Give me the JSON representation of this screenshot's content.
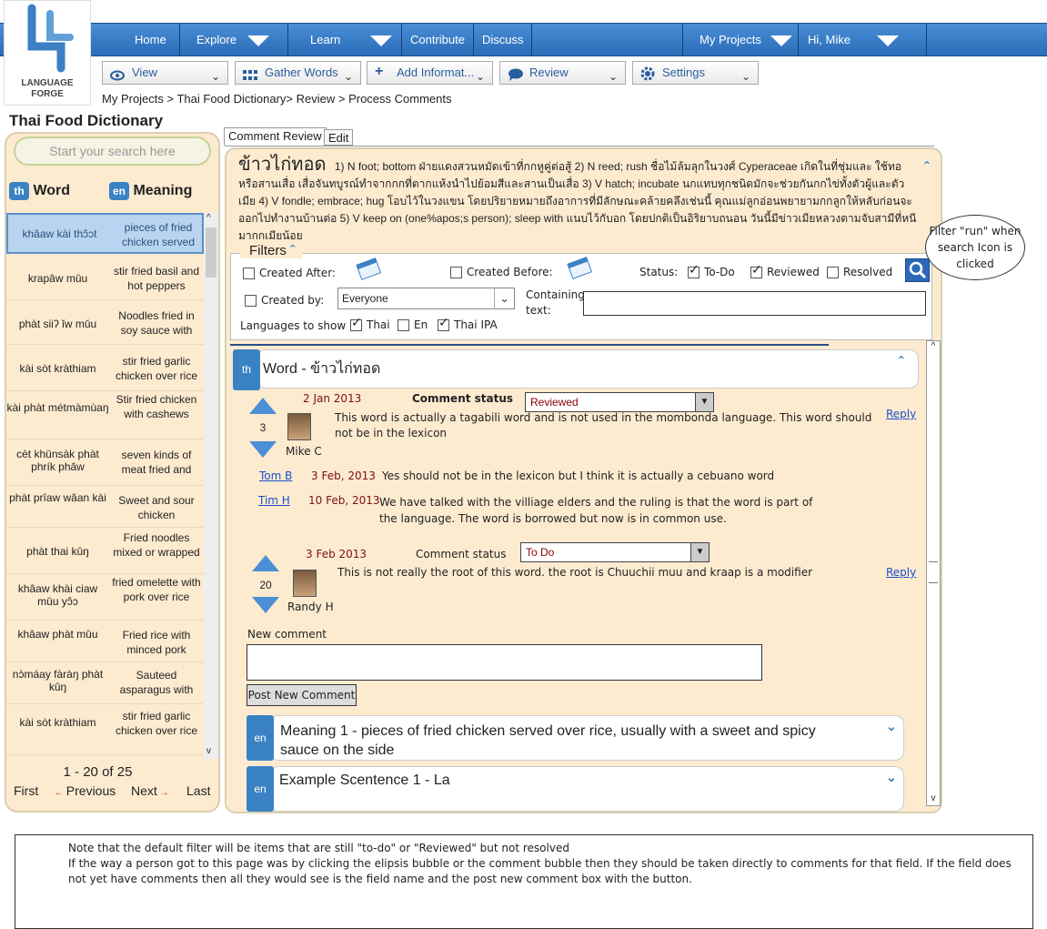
{
  "logo": {
    "line1": "LANGUAGE",
    "line2": "FORGE"
  },
  "topnav": {
    "home": "Home",
    "explore": "Explore",
    "learn": "Learn",
    "contribute": "Contribute",
    "discuss": "Discuss",
    "my_projects": "My Projects",
    "greeting": "Hi, Mike"
  },
  "subnav": {
    "view": "View",
    "gather_words": "Gather Words",
    "add_information": "Add Informat...",
    "review": "Review",
    "settings": "Settings"
  },
  "breadcrumb": "My Projects > Thai Food Dictionary> Review > Process Comments",
  "page_title": "Thai Food Dictionary",
  "left": {
    "search_placeholder": "Start your search here",
    "word_lang": "th",
    "word_header": "Word",
    "meaning_lang": "en",
    "meaning_header": "Meaning",
    "rows": [
      {
        "word": "khâaw kài thɔ̂ɔt",
        "meaning": "pieces of fried chicken served"
      },
      {
        "word": "krapâw mǔu",
        "meaning": "stir fried basil and hot peppers"
      },
      {
        "word": "phàt siiʔ ǐw mǔu",
        "meaning": "Noodles fried in soy sauce with"
      },
      {
        "word": "kài sòt kràthiam",
        "meaning": "stir fried garlic chicken over rice"
      },
      {
        "word": "kài phàt métmàmùaŋ",
        "meaning": "Stir fried chicken with cashews"
      },
      {
        "word": "cèt khǔnsàk phàt phrík phǎw",
        "meaning": "seven kinds of meat fried and"
      },
      {
        "word": "phàt prîaw wǎan kài",
        "meaning": "Sweet and sour chicken"
      },
      {
        "word": "phàt thai kûŋ",
        "meaning": "Fried noodles mixed or wrapped"
      },
      {
        "word": "khâaw khài ciaw mǔu yɔ̂ɔ",
        "meaning": "fried omelette with pork over rice"
      },
      {
        "word": "khâaw phàt mǔu",
        "meaning": "Fried rice with minced pork"
      },
      {
        "word": "nɔ̀máay fàràŋ phàt kûŋ",
        "meaning": "Sauteed asparagus with"
      },
      {
        "word": "kài sòt kràthiam",
        "meaning": "stir fried garlic chicken over rice"
      }
    ],
    "pager": {
      "range": "1 - 20 of 25",
      "first": "First",
      "previous": "Previous",
      "next": "Next",
      "last": "Last"
    }
  },
  "tabs": {
    "comment_review": "Comment Review",
    "edit": "Edit"
  },
  "entry": {
    "headword": "ข้าวไก่ทอด",
    "text": "1) N  foot; bottom ฝ่ายแดงสวนหมัดเข้าที่กกหูคู่ต่อสู้    2) N  reed; rush ชื่อไม้ล้มลุกในวงศ์ Cyperaceae เกิดในที่ชุ่มและ ใช้ทอหรือสานเสื่อ เสื่อจันทบูรณ์ทำจากกกที่ตากแห้งนำไปย้อมสีและสานเป็นเสื่อ    3) V  hatch; incubate นกแทบทุกชนิดมักจะช่วยกันกกไข่ทั้งตัวผู้และตัวเมีย    4) V  fondle; embrace; hug โอบไว้ในวงแขน โดยปริยายหมายถึงอาการที่มีลักษณะคล้ายคลึงเช่นนี้ คุณแม่ลูกอ่อนพยายามกกลูกให้หลับก่อนจะออกไปทำงานบ้านต่อ    5) V  keep on (one%apos;s person); sleep with แนบไว้กับอก โดยปกติเป็นอิริยาบถนอน วันนี้มีข่าวเมียหลวงตามจับสามีที่หนีมากกเมียน้อย"
  },
  "filters": {
    "title": "Filters",
    "created_after": "Created After:",
    "created_before": "Created Before:",
    "status_label": "Status:",
    "todo": "To-Do",
    "reviewed": "Reviewed",
    "resolved": "Resolved",
    "created_by": "Created by:",
    "created_by_value": "Everyone",
    "containing_text": "Containing text:",
    "languages_label": "Languages to show",
    "lang_thai": "Thai",
    "lang_en": "En",
    "lang_ipa": "Thai IPA"
  },
  "callout": "Filter \"run\" when search Icon is clicked",
  "word_section": {
    "lang": "th",
    "title": "Word - ข้าวไก่ทอด"
  },
  "comments": [
    {
      "date": "2 Jan 2013",
      "status_label": "Comment status",
      "status": "Reviewed",
      "votes": "3",
      "author": "Mike C",
      "text": "This word is actually a tagabili word and is not used in the mombonda language. This word should not be in the lexicon",
      "reply": "Reply",
      "replies": [
        {
          "author": "Tom B",
          "date": "3 Feb, 2013",
          "text": "Yes should not be in the lexicon but I think it is actually a cebuano word"
        },
        {
          "author": "Tim H",
          "date": "10 Feb, 2013",
          "text": "We have talked with the villiage elders and the ruling is that the word is part of the language. The word is borrowed but now is in common use."
        }
      ]
    },
    {
      "date": "3 Feb 2013",
      "status_label": "Comment status",
      "status": "To Do",
      "votes": "20",
      "author": "Randy H",
      "text": "This is not really the root of this word. the root is Chuuchii muu and kraap is a modifier",
      "reply": "Reply"
    }
  ],
  "new_comment": {
    "label": "New comment",
    "button": "Post New Comment"
  },
  "meaning_section": {
    "lang": "en",
    "title": "Meaning 1 - pieces of fried chicken served over rice, usually with a sweet and spicy sauce on the side"
  },
  "example_section": {
    "lang": "en",
    "title": "Example Scentence 1 - La"
  },
  "notes": {
    "line1": "Note that the default filter will be items that are still \"to-do\" or \"Reviewed\" but not resolved",
    "line2": "If the way a person got to this page was by clicking the elipsis bubble or the comment bubble then they should be taken directly to comments for that field. If the field does not yet have comments then all they would see is the field name and the post new comment box with the button."
  },
  "colors": {
    "nav": "#3576c4",
    "accent": "#3b82c4",
    "panel": "#fdebd0"
  }
}
